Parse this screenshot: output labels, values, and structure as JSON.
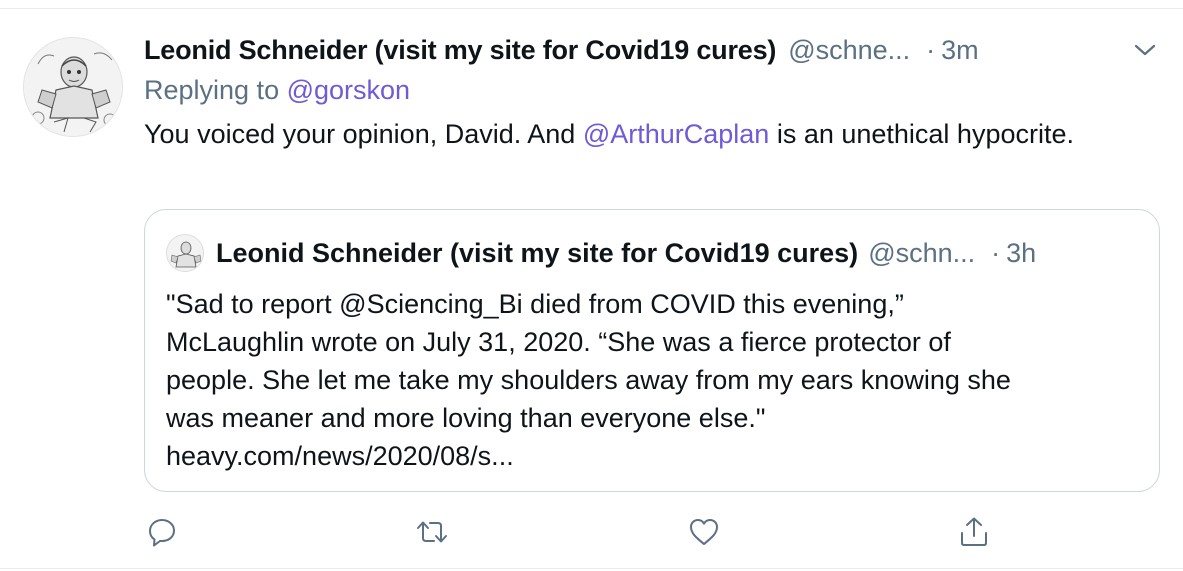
{
  "tweet": {
    "author_name": "Leonid Schneider (visit my site for Covid19 cures)",
    "author_handle": "@schne...",
    "separator": "·",
    "time": "3m",
    "replying_prefix": "Replying to",
    "replying_to": "@gorskon",
    "text_part1": "You voiced your opinion, David. And ",
    "text_mention": "@ArthurCaplan",
    "text_part2": " is an unethical hypocrite.",
    "avatar_icon": "sketch-portrait-avatar",
    "menu_icon": "chevron-down-icon"
  },
  "quote": {
    "author_name": "Leonid Schneider (visit my site for Covid19 cures)",
    "author_handle": "@schn...",
    "separator": "·",
    "time": "3h",
    "lines": [
      "\"Sad to report @Sciencing_Bi died from COVID this evening,”",
      "McLaughlin wrote on July 31, 2020. “She was a fierce protector of",
      "people. She let me take my shoulders away from my ears knowing she",
      "was meaner and more loving than everyone else.\"",
      "heavy.com/news/2020/08/s..."
    ]
  },
  "actions": [
    "reply-icon",
    "retweet-icon",
    "like-icon",
    "share-icon"
  ],
  "colors": {
    "mention": "#6e5bd6",
    "secondary_text": "#5b7083",
    "border": "#ccd6dd",
    "icon": "#5b7083"
  }
}
